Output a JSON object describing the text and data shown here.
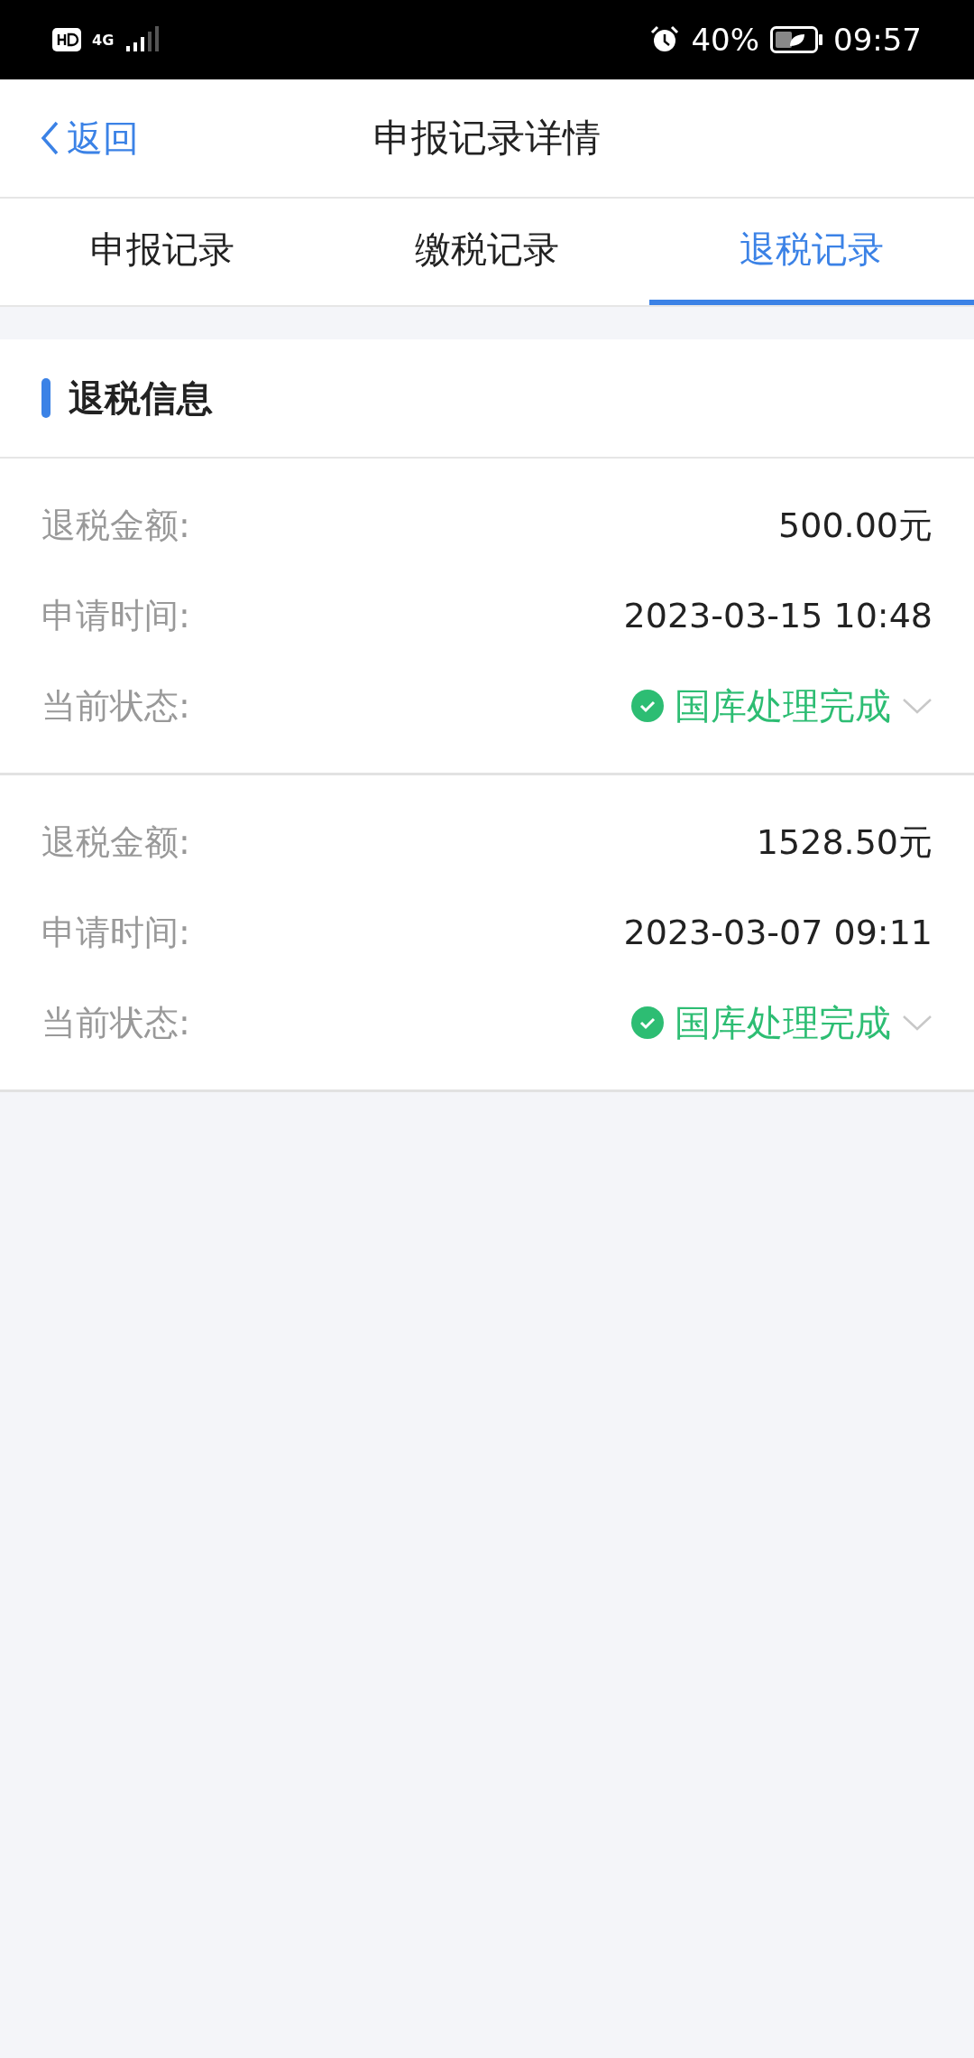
{
  "status_bar": {
    "network": "4G",
    "battery": "40%",
    "time": "09:57"
  },
  "nav": {
    "back": "返回",
    "title": "申报记录详情"
  },
  "tabs": [
    {
      "label": "申报记录",
      "selected": false
    },
    {
      "label": "缴税记录",
      "selected": false
    },
    {
      "label": "退税记录",
      "selected": true
    }
  ],
  "section": {
    "title": "退税信息"
  },
  "records": [
    {
      "fields": [
        {
          "label": "退税金额:",
          "value": "500.00元"
        },
        {
          "label": "申请时间:",
          "value": "2023-03-15 10:48"
        }
      ],
      "status": {
        "label": "当前状态:",
        "value": "国库处理完成",
        "kind": "done"
      }
    },
    {
      "fields": [
        {
          "label": "退税金额:",
          "value": "1528.50元"
        },
        {
          "label": "申请时间:",
          "value": "2023-03-07 09:11"
        }
      ],
      "status": {
        "label": "当前状态:",
        "value": "国库处理完成",
        "kind": "done"
      }
    }
  ]
}
